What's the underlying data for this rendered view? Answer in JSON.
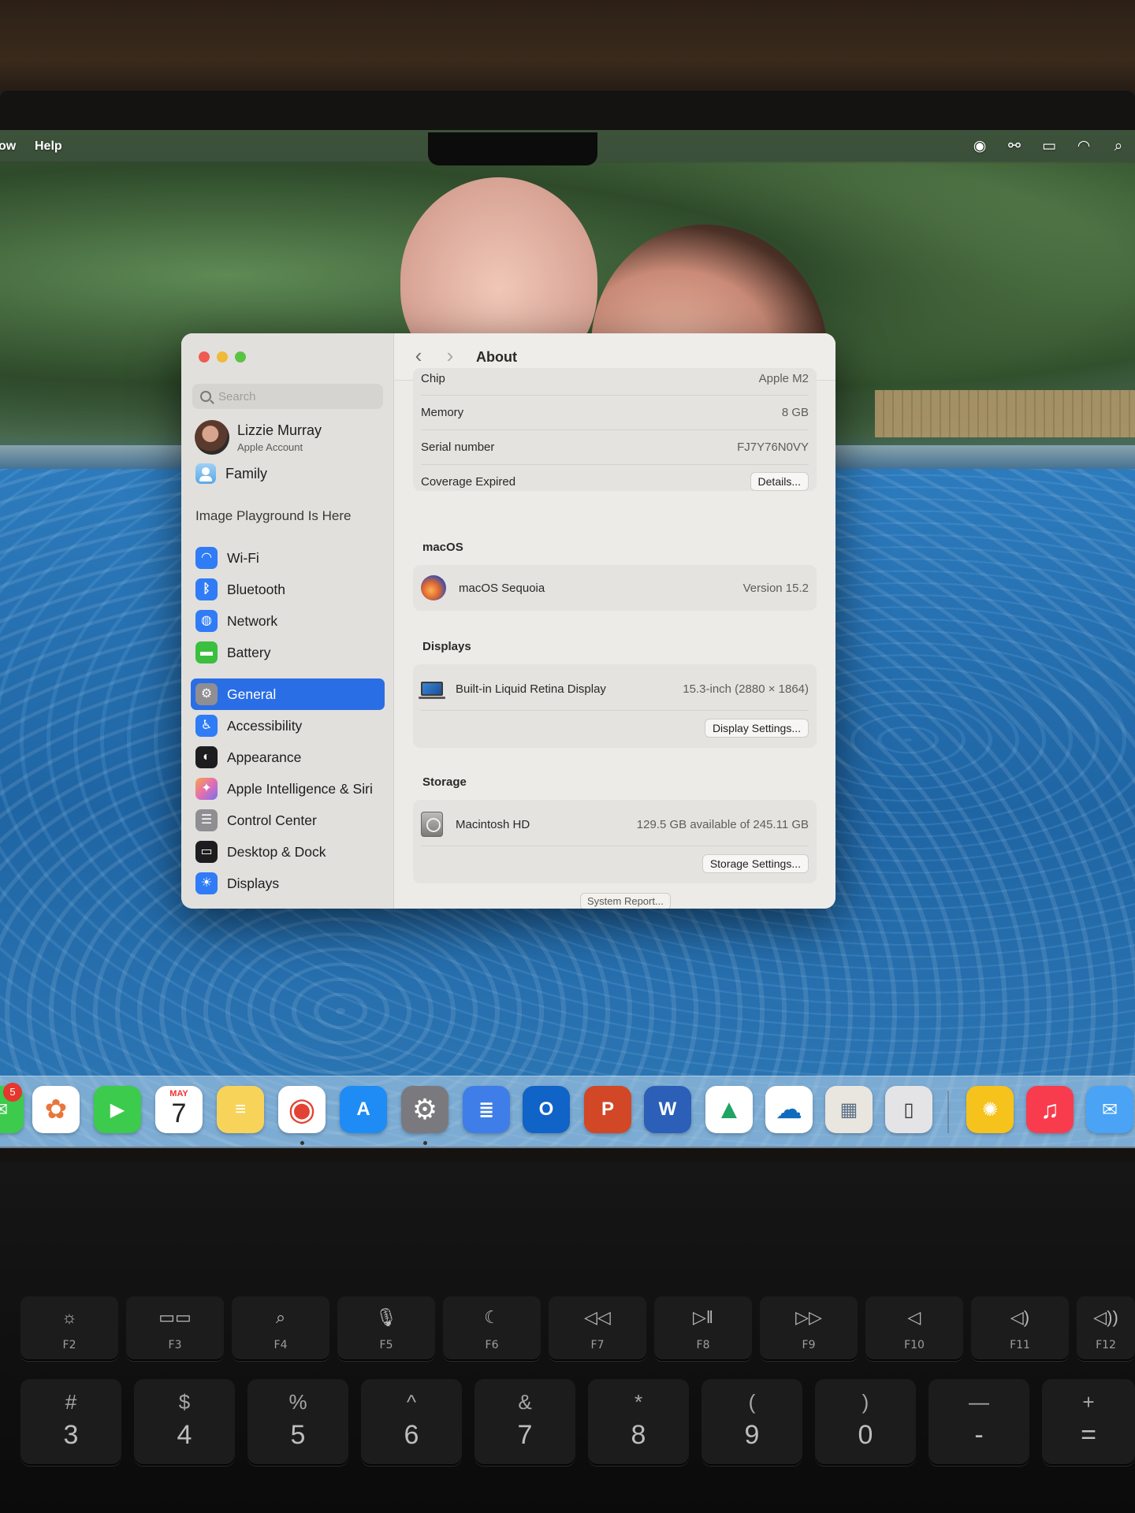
{
  "menubar": {
    "items": [
      "ow",
      "Help"
    ]
  },
  "window": {
    "title": "About",
    "sidebar": {
      "search_placeholder": "Search",
      "account": {
        "name": "Lizzie Murray",
        "subtitle": "Apple Account"
      },
      "family": "Family",
      "promo": "Image Playground Is Here",
      "items": [
        {
          "label": "Wi-Fi",
          "icon": "wifi-icon",
          "color": "#2f7cf6"
        },
        {
          "label": "Bluetooth",
          "icon": "bluetooth-icon",
          "color": "#2f7cf6"
        },
        {
          "label": "Network",
          "icon": "globe-icon",
          "color": "#2f7cf6"
        },
        {
          "label": "Battery",
          "icon": "battery-icon",
          "color": "#3bbf3f"
        },
        {
          "label": "General",
          "icon": "gear-icon",
          "color": "#8e8e93",
          "active": true
        },
        {
          "label": "Accessibility",
          "icon": "accessibility-icon",
          "color": "#2f7cf6"
        },
        {
          "label": "Appearance",
          "icon": "appearance-icon",
          "color": "#1d1d1f"
        },
        {
          "label": "Apple Intelligence & Siri",
          "icon": "siri-icon",
          "color": "#e36fb0"
        },
        {
          "label": "Control Center",
          "icon": "control-center-icon",
          "color": "#8e8e93"
        },
        {
          "label": "Desktop & Dock",
          "icon": "desktop-dock-icon",
          "color": "#1d1d1f"
        },
        {
          "label": "Displays",
          "icon": "displays-icon",
          "color": "#2f7cf6"
        }
      ]
    },
    "about": {
      "chip": {
        "label": "Chip",
        "value": "Apple M2"
      },
      "memory": {
        "label": "Memory",
        "value": "8 GB"
      },
      "serial": {
        "label": "Serial number",
        "value": "FJ7Y76N0VY"
      },
      "coverage": {
        "label": "Coverage Expired",
        "button": "Details..."
      },
      "macos": {
        "section": "macOS",
        "name": "macOS Sequoia",
        "version": "Version 15.2"
      },
      "displays": {
        "section": "Displays",
        "name": "Built-in Liquid Retina Display",
        "value": "15.3-inch (2880 × 1864)",
        "button": "Display Settings..."
      },
      "storage": {
        "section": "Storage",
        "name": "Macintosh HD",
        "value": "129.5 GB available of 245.11 GB",
        "button": "Storage Settings..."
      },
      "system_report": "System Report..."
    }
  },
  "dock": {
    "badge": "5",
    "calendar": {
      "month": "MAY",
      "day": "7"
    },
    "apps": [
      {
        "name": "Photos",
        "color": "#ffffff"
      },
      {
        "name": "FaceTime",
        "color": "#3ccb4c"
      },
      {
        "name": "Calendar",
        "color": "#ffffff"
      },
      {
        "name": "Notes",
        "color": "#f7d35a"
      },
      {
        "name": "Chrome",
        "color": "#ffffff"
      },
      {
        "name": "App Store",
        "color": "#1f8cf5"
      },
      {
        "name": "System Settings",
        "color": "#7a7a7e"
      },
      {
        "name": "Google Docs",
        "color": "#3f7ee8"
      },
      {
        "name": "Outlook",
        "color": "#1063c7"
      },
      {
        "name": "PowerPoint",
        "color": "#d24726"
      },
      {
        "name": "Word",
        "color": "#2b5fb8"
      },
      {
        "name": "Google Drive",
        "color": "#ffffff"
      },
      {
        "name": "OneDrive",
        "color": "#ffffff"
      },
      {
        "name": "Preview",
        "color": "#e9e6e0"
      },
      {
        "name": "iPhone Mirroring",
        "color": "#e4e4e6"
      },
      {
        "name": "Tips",
        "color": "#f6c21c"
      },
      {
        "name": "Music",
        "color": "#f83c4e"
      },
      {
        "name": "Mail",
        "color": "#4aa3f5"
      }
    ]
  },
  "keyboard": {
    "fkeys": [
      "F2",
      "F3",
      "F4",
      "F5",
      "F6",
      "F7",
      "F8",
      "F9",
      "F10",
      "F11",
      "F12"
    ],
    "numkeys": [
      {
        "sym": "#",
        "num": "3"
      },
      {
        "sym": "$",
        "num": "4"
      },
      {
        "sym": "%",
        "num": "5"
      },
      {
        "sym": "^",
        "num": "6"
      },
      {
        "sym": "&",
        "num": "7"
      },
      {
        "sym": "*",
        "num": "8"
      },
      {
        "sym": "(",
        "num": "9"
      },
      {
        "sym": ")",
        "num": "0"
      },
      {
        "sym": "—",
        "num": "-"
      },
      {
        "sym": "+",
        "num": "="
      }
    ]
  }
}
